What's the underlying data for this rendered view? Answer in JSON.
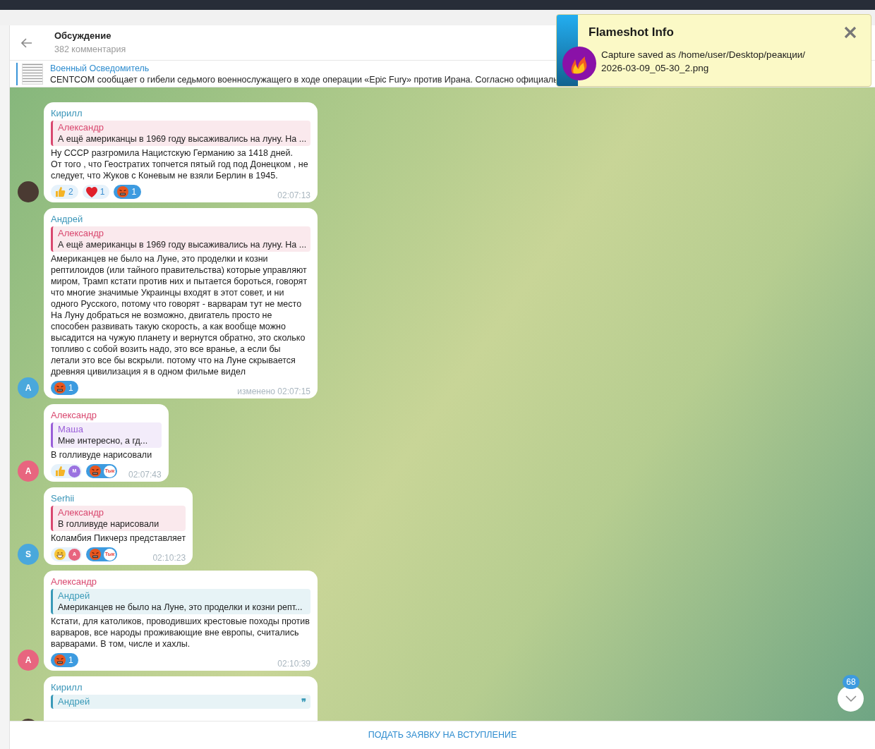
{
  "header": {
    "title": "Обсуждение",
    "subtitle": "382 комментария"
  },
  "pinned": {
    "channel": "Военный Осведомитель",
    "text": "CENTCOM сообщает о гибели седьмого военнослужащего в ходе операции «Epic Fury» против Ирана.  Согласно официаль"
  },
  "messages": [
    {
      "author": "Кирилл",
      "color": "#3a95b8",
      "avatar": {
        "kind": "photo"
      },
      "reply": {
        "author": "Александр",
        "text": "А ещё американцы в 1969 году высаживались на луну. На ...",
        "color": "#d9486f"
      },
      "text": "Ну СССР разгромила Нацистскую Германию за 1418 дней.\nОт того , что Геостратих топчется пятый год под Донецком , не следует, что Жуков с Коневым не взяли Берлин в 1945.",
      "reactions": [
        {
          "kind": "thumbs",
          "count": "2",
          "selected": false
        },
        {
          "kind": "heart",
          "count": "1",
          "selected": false
        },
        {
          "kind": "angry",
          "count": "1",
          "selected": true
        }
      ],
      "time": "02:07:13"
    },
    {
      "author": "Андрей",
      "color": "#3a95b8",
      "avatar": {
        "kind": "letter",
        "letter": "А",
        "color": "#4aa8dc"
      },
      "reply": {
        "author": "Александр",
        "text": "А ещё американцы в 1969 году высаживались на луну. На ...",
        "color": "#d9486f"
      },
      "text": "Американцев не было на Луне, это проделки и козни рептилоидов (или тайного правительства) которые управляют миром, Трамп кстати против них и пытается бороться, говорят что многие значимые Украинцы входят в этот совет, и ни одного Русского, потому что говорят - варварам тут не место\nНа Луну добраться не возможно, двигатель просто не способен развивать такую скорость, а как вообще можно высадится на чужую планету и вернутся обратно, это сколько топливо с собой возить надо, это все вранье, а если бы летали это все бы вскрыли. потому что на Луне скрывается древняя цивилизация я в одном фильме видел",
      "reactions": [
        {
          "kind": "angry",
          "count": "1",
          "selected": true
        }
      ],
      "edited": "изменено",
      "time": "02:07:15"
    },
    {
      "author": "Александр",
      "color": "#d9486f",
      "avatar": {
        "kind": "letter",
        "letter": "А",
        "color": "#e8657f"
      },
      "reply": {
        "author": "Маша",
        "text": "Мне интересно, а гд...",
        "color": "#9a5fd9"
      },
      "text": "В голливуде нарисовали",
      "reactions": [
        {
          "kind": "thumbs",
          "avatars": [
            {
              "kind": "letter",
              "letter": "М",
              "color": "#9b72e0"
            }
          ],
          "selected": false
        },
        {
          "kind": "angry",
          "avatars": [
            {
              "kind": "sticker",
              "letter": "Тык"
            }
          ],
          "selected": true
        }
      ],
      "time": "02:07:43"
    },
    {
      "author": "Serhii",
      "color": "#3a95b8",
      "avatar": {
        "kind": "letter",
        "letter": "S",
        "color": "#4aa8dc"
      },
      "reply": {
        "author": "Александр",
        "text": "В голливуде нарисовали",
        "color": "#d9486f"
      },
      "text": "Коламбия Пикчерз представляет",
      "reactions": [
        {
          "kind": "grin",
          "avatars": [
            {
              "kind": "letter",
              "letter": "А",
              "color": "#e8657f"
            }
          ],
          "selected": false
        },
        {
          "kind": "angry",
          "avatars": [
            {
              "kind": "sticker",
              "letter": "Тык"
            }
          ],
          "selected": true
        }
      ],
      "time": "02:10:23"
    },
    {
      "author": "Александр",
      "color": "#d9486f",
      "avatar": {
        "kind": "letter",
        "letter": "А",
        "color": "#e8657f"
      },
      "reply": {
        "author": "Андрей",
        "text": "Американцев не было на Луне, это проделки и козни репт...",
        "color": "#3a9ab8"
      },
      "text": "Кстати, для католиков, проводивших крестовые походы против варваров, все народы проживающие вне европы, считались варварами. В том, числе и хахлы.",
      "reactions": [
        {
          "kind": "angry",
          "count": "1",
          "selected": true
        }
      ],
      "time": "02:10:39"
    },
    {
      "author": "Кирилл",
      "color": "#3a95b8",
      "avatar": {
        "kind": "photo"
      },
      "reply": {
        "author": "Андрей",
        "color": "#3a9ab8",
        "quote_mark": "❞"
      }
    }
  ],
  "scroll_badge": "68",
  "join_button": "ПОДАТЬ ЗАЯВКУ НА ВСТУПЛЕНИЕ",
  "notification": {
    "title": "Flameshot Info",
    "text": "Capture saved as /home/user/Desktop/реакции/\n2026-03-09_05-30_2.png"
  }
}
